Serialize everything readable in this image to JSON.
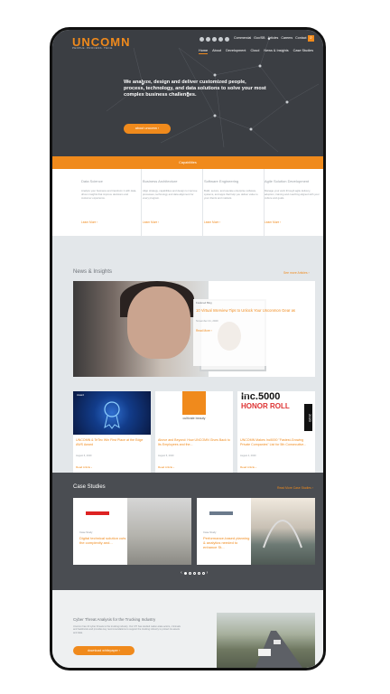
{
  "header": {
    "logo": "UNCOMN",
    "tagline": "PEOPLE. PROCESS. TECH.",
    "utility": [
      "Commercial",
      "Gov/SB",
      "Articles",
      "Careers",
      "Contact"
    ],
    "nav": [
      "Home",
      "About",
      "Development",
      "Cloud",
      "News & Insights",
      "Case Studies"
    ],
    "social_icons": [
      "facebook-icon",
      "twitter-icon",
      "linkedin-icon",
      "youtube-icon",
      "instagram-icon"
    ],
    "search_icon": "search-icon"
  },
  "hero": {
    "headline": "We analyze, design and deliver customized people, process, technology, and data solutions to solve your most complex business challenges.",
    "about_button": "about uncomn  ›"
  },
  "capabilities": {
    "bar_label": "Capabilities",
    "items": [
      {
        "title": "Data Science",
        "body": "Analyze your business and transform it with data-driven insights that improve decisions and customer experience.",
        "link": "Learn More ›"
      },
      {
        "title": "Business Architecture",
        "body": "Align strategy, capabilities and design to improve processes, technology and data alignment for every program.",
        "link": "Learn More ›"
      },
      {
        "title": "Software Engineering",
        "body": "Build, secure, and operate enterprise software, systems, and apps that help you deliver value to your clients and markets.",
        "link": "Learn More ›"
      },
      {
        "title": "Agile Solution Development",
        "body": "Manage your work through agile delivery, adoption, training and coaching aligned with your culture and goals.",
        "link": "Learn More ›"
      }
    ]
  },
  "news": {
    "title": "News & Insights",
    "see_more": "See more Articles ›",
    "featured": {
      "tag": "Featured Blog",
      "title": "10 Virtual Interview Tips to Unlock Your Unconmon Gear as",
      "date": "November 21, 2020",
      "more": "Read More ›"
    },
    "cards": [
      {
        "tag": "Award",
        "title": "UNCOMN & TeTec Win First Place at the Edge AWS Award",
        "date": "August 6, 2020",
        "more": "Read Article ›"
      },
      {
        "tag": "Events",
        "title": "Above and Beyond: How UNCOMN Gives Back to Its Employees and the...",
        "date": "August 5, 2020",
        "more": "Read Article ›",
        "logo_text": "cultivate beauty"
      },
      {
        "tag": "Award",
        "title": "UNCOMN Makes Inc5000 \"Fastest-Growing Private Companies\" List for 5th Consecutive...",
        "date": "August 4, 2020",
        "more": "Read Article ›",
        "logo_text": "Inc.5000",
        "honor": "HONOR ROLL",
        "year": "2020"
      }
    ]
  },
  "cases": {
    "title": "Case Studies",
    "see_more": "Read More Case Studies ›",
    "items": [
      {
        "tag": "Case Study",
        "title": "Digital technical solution cuts the complexity and..."
      },
      {
        "tag": "Case Study",
        "title": "Performance-based planning & analytics needed to enhance St..."
      }
    ]
  },
  "whitepaper": {
    "title": "Cyber Threat Analysis for the Trucking Industry",
    "body": "Uncomn has 10 cyber threats to the trucking industry. Our CTI has studied nation-state actors, criminals and hacktivists and provides key recommendations to support the trucking industry to protect its assets and data.",
    "button": "download whitepaper  ›"
  },
  "colors": {
    "accent": "#f08a1c",
    "dark": "#3b3e43",
    "case_bg": "#4a4d52"
  }
}
